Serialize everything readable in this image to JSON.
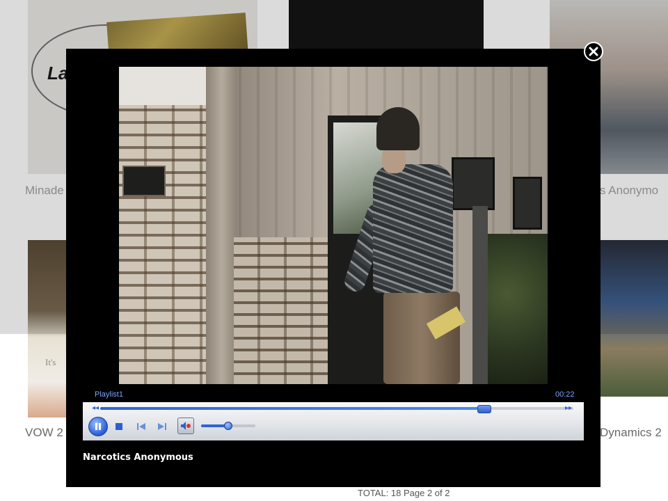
{
  "background": {
    "captions": [
      "Minade",
      "s Anonymo",
      "VOW 2",
      "Dynamics 2"
    ],
    "tile_logo_text": "La",
    "tile_inner_text": "It's",
    "pagination": "TOTAL: 18 Page 2 of 2"
  },
  "player": {
    "playlist_label": "Playlist1",
    "time": "00:22",
    "progress_percent": 81,
    "volume_percent": 50,
    "state": "playing"
  },
  "video": {
    "title": "Narcotics Anonymous"
  },
  "icons": {
    "close": "close-icon",
    "play_pause": "pause-icon",
    "stop": "stop-icon",
    "prev": "previous-icon",
    "next": "next-icon",
    "mute": "speaker-icon",
    "rewind": "rewind-icon",
    "forward": "fast-forward-icon"
  },
  "colors": {
    "accent": "#2f63d6",
    "label": "#7ba7ff",
    "overlay": "#000000"
  }
}
